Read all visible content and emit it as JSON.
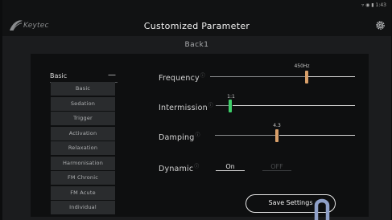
{
  "header": {
    "logo_text": "Keytec",
    "title": "Customized Parameter",
    "status_text": "▿ ◉ ▮ 1:43"
  },
  "profile_name": "Back1",
  "menu": {
    "header_label": "Basic",
    "header_symbol": "—",
    "items": [
      "Basic",
      "Sedation",
      "Trigger",
      "Activation",
      "Relaxation",
      "Harmonisation",
      "FM Chronic",
      "FM Acute",
      "Individual"
    ]
  },
  "parameters": {
    "frequency": {
      "label": "Frequency",
      "value_text": "450Hz",
      "level": 0.52,
      "thumb_color": "#d9a06a"
    },
    "intermission": {
      "label": "Intermission",
      "value_text": "1:1",
      "level": 0.0,
      "thumb_color": "#3ecf6a"
    },
    "damping": {
      "label": "Damping",
      "value_text": "4.3",
      "level": 0.43,
      "thumb_color": "#d9a06a"
    },
    "dynamic": {
      "label": "Dynamic",
      "on_label": "On",
      "off_label": "OFF",
      "selected": "On"
    }
  },
  "info_symbol": "ⓘ",
  "save_button_label": "Save Settings",
  "colors": {
    "background": "#1b1c1e",
    "panel": "#0e0f10",
    "thumb_accent": "#d9a06a",
    "thumb_intermission": "#3ecf6a",
    "cursor_hand": "#8fa0c8"
  },
  "icons": [
    "keytec-logo-icon",
    "gear-icon",
    "info-icon",
    "hand-cursor-icon"
  ]
}
